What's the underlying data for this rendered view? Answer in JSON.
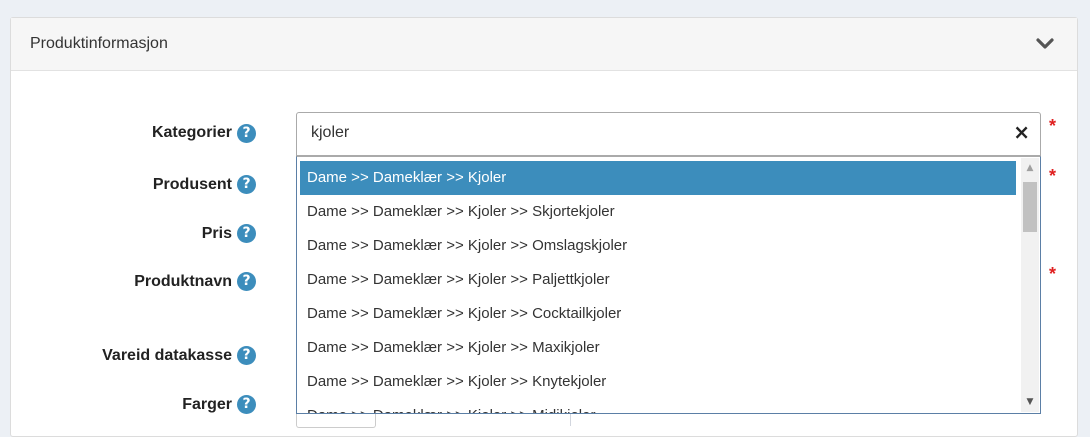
{
  "panel": {
    "title": "Produktinformasjon",
    "collapse_icon": "chevron-down-icon"
  },
  "form": {
    "rows": [
      {
        "label": "Kategorier",
        "help": "?",
        "required": "*"
      },
      {
        "label": "Produsent",
        "help": "?",
        "required": "*"
      },
      {
        "label": "Pris",
        "help": "?"
      },
      {
        "label": "Produktnavn",
        "help": "?",
        "required": "*"
      },
      {
        "label": "Vareid datakasse",
        "help": "?"
      },
      {
        "label": "Farger",
        "help": "?"
      }
    ]
  },
  "category_select": {
    "search_value": "kjoler",
    "clear_glyph": "×",
    "options": [
      {
        "label": "Dame >> Dameklær >> Kjoler",
        "highlighted": true
      },
      {
        "label": "Dame >> Dameklær >> Kjoler >> Skjortekjoler"
      },
      {
        "label": "Dame >> Dameklær >> Kjoler >> Omslagskjoler"
      },
      {
        "label": "Dame >> Dameklær >> Kjoler >> Paljettkjoler"
      },
      {
        "label": "Dame >> Dameklær >> Kjoler >> Cocktailkjoler"
      },
      {
        "label": "Dame >> Dameklær >> Kjoler >> Maxikjoler"
      },
      {
        "label": "Dame >> Dameklær >> Kjoler >> Knytekjoler"
      },
      {
        "label": "Dame >> Dameklær >> Kjoler >> Midikjoler"
      }
    ]
  },
  "colors": {
    "accent": "#3c8dbc",
    "required": "#e02020"
  }
}
